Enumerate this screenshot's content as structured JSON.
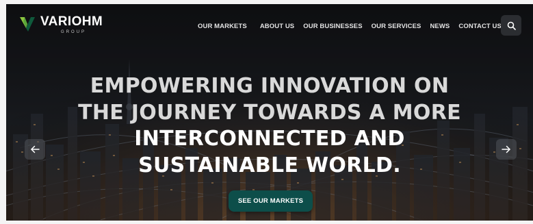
{
  "brand": {
    "name": "VARIOHM",
    "subtitle": "GROUP",
    "icon": "variohm-v-logo-icon",
    "colors": {
      "mark_light": "#8dc63f",
      "mark_dark": "#0f5a3c"
    }
  },
  "nav": {
    "items": [
      {
        "label": "OUR MARKETS"
      },
      {
        "label": "ABOUT US"
      },
      {
        "label": "OUR BUSINESSES"
      },
      {
        "label": "OUR SERVICES"
      },
      {
        "label": "NEWS"
      },
      {
        "label": "CONTACT US"
      }
    ],
    "search_icon": "search-icon"
  },
  "hero": {
    "headline_lines": [
      "EMPOWERING INNOVATION ON",
      "THE JOURNEY TOWARDS A MORE",
      "INTERCONNECTED AND",
      "SUSTAINABLE WORLD."
    ],
    "cta_label": "SEE OUR MARKETS",
    "prev_icon": "arrow-left-icon",
    "next_icon": "arrow-right-icon",
    "background": "city-skyline-network-image"
  },
  "colors": {
    "cta_bg": "#0d4e4a",
    "header_text": "#e4e4e4",
    "search_bg": "#2b2d31"
  }
}
